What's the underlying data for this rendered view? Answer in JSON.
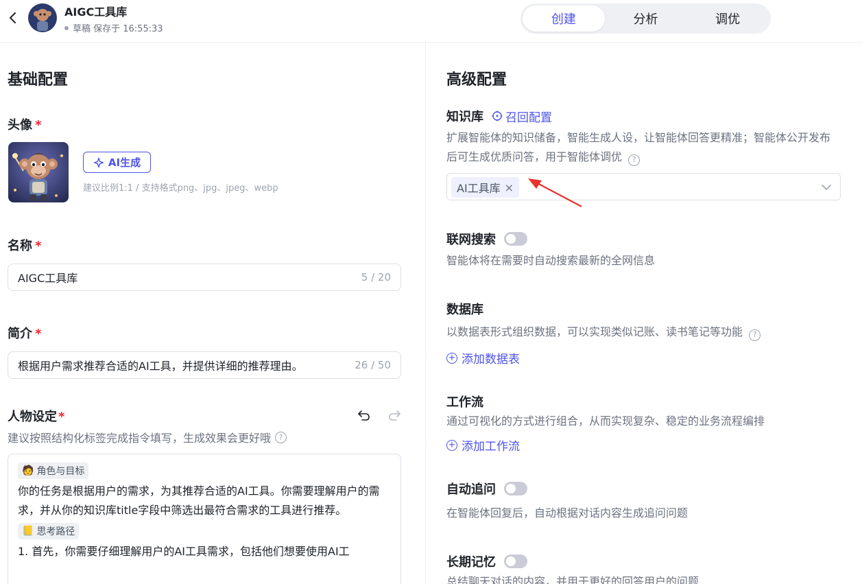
{
  "header": {
    "app_title": "AIGC工具库",
    "status": "草稿 保存于 16:55:33",
    "tabs": [
      {
        "label": "创建",
        "active": true
      },
      {
        "label": "分析",
        "active": false
      },
      {
        "label": "调优",
        "active": false
      }
    ]
  },
  "basic": {
    "title": "基础配置",
    "avatar_label": "头像",
    "ai_button": "AI生成",
    "avatar_hint": "建议比例1:1 / 支持格式png、jpg、jpeg、webp",
    "name_label": "名称",
    "name_value": "AIGC工具库",
    "name_count": "5 / 20",
    "intro_label": "简介",
    "intro_value": "根据用户需求推荐合适的AI工具，并提供详细的推荐理由。",
    "intro_count": "26 / 50",
    "persona_label": "人物设定",
    "persona_hint": "建议按照结构化标签完成指令填写，生成效果会更好哦",
    "persona_tag1": "角色与目标",
    "persona_text1": "你的任务是根据用户的需求，为其推荐合适的AI工具。你需要理解用户的需求，并从你的知识库title字段中筛选出最符合需求的工具进行推荐。",
    "persona_tag2": "思考路径",
    "persona_text2": "1. 首先，你需要仔细理解用户的AI工具需求，包括他们想要使用AI工"
  },
  "advanced": {
    "title": "高级配置",
    "kb_label": "知识库",
    "kb_recall": "召回配置",
    "kb_desc": "扩展智能体的知识储备，智能生成人设，让智能体回答更精准；智能体公开发布后可生成优质问答，用于智能体调优",
    "kb_selected": "AI工具库",
    "web_label": "联网搜索",
    "web_desc": "智能体将在需要时自动搜索最新的全网信息",
    "db_label": "数据库",
    "db_desc": "以数据表形式组织数据，可以实现类似记账、读书笔记等功能",
    "db_add": "添加数据表",
    "wf_label": "工作流",
    "wf_desc": "通过可视化的方式进行组合，从而实现复杂、稳定的业务流程编排",
    "wf_add": "添加工作流",
    "followup_label": "自动追问",
    "followup_desc": "在智能体回复后，自动根据对话内容生成追问问题",
    "memory_label": "长期记忆",
    "memory_desc": "总结聊天对话的内容，并用于更好的回答用户的问题"
  },
  "colors": {
    "accent": "#4d53e8",
    "required": "#f5222d",
    "arrow": "#e8322a"
  }
}
